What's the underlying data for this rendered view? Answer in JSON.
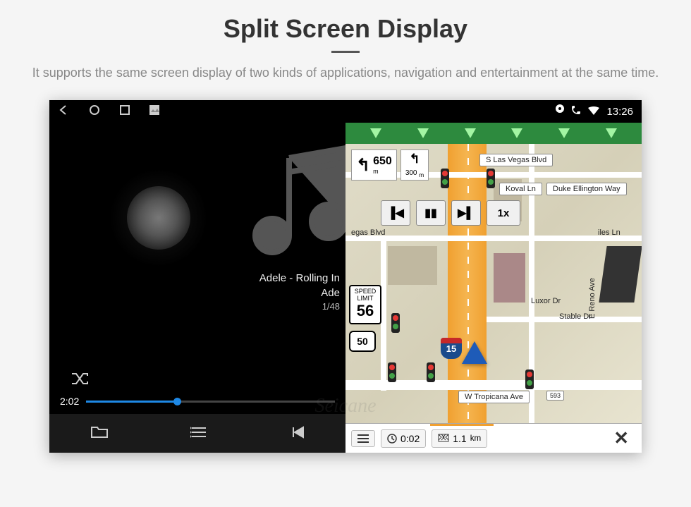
{
  "header": {
    "title": "Split Screen Display",
    "description": "It supports the same screen display of two kinds of applications, navigation and entertainment at the same time."
  },
  "music": {
    "track_title": "Adele - Rolling In",
    "artist": "Ade",
    "track_index": "1/48",
    "elapsed": "2:02",
    "progress_percent": 35
  },
  "nav": {
    "status_time": "13:26",
    "turn1_dist": "650",
    "turn1_unit": "m",
    "turn2_dist": "300",
    "turn2_unit": "m",
    "speed_limit_label": "SPEED\nLIMIT",
    "speed_limit_value": "56",
    "hwy_shield": "50",
    "interstate": "15",
    "playback_speed": "1x",
    "streets": {
      "s_lv": "S Las Vegas Blvd",
      "koval": "Koval Ln",
      "duke": "Duke Ellington Way",
      "vegas_blvd": "egas Blvd",
      "luxor": "Luxor Dr",
      "stable": "Stable Dr",
      "reno": "E Reno Ave",
      "tropicana": "W Tropicana Ave",
      "trop_num": "593",
      "iles": "iles Ln"
    },
    "bottom": {
      "time": "0:02",
      "dist_value": "1.1",
      "dist_unit": "km"
    }
  },
  "watermark": "Seicane"
}
